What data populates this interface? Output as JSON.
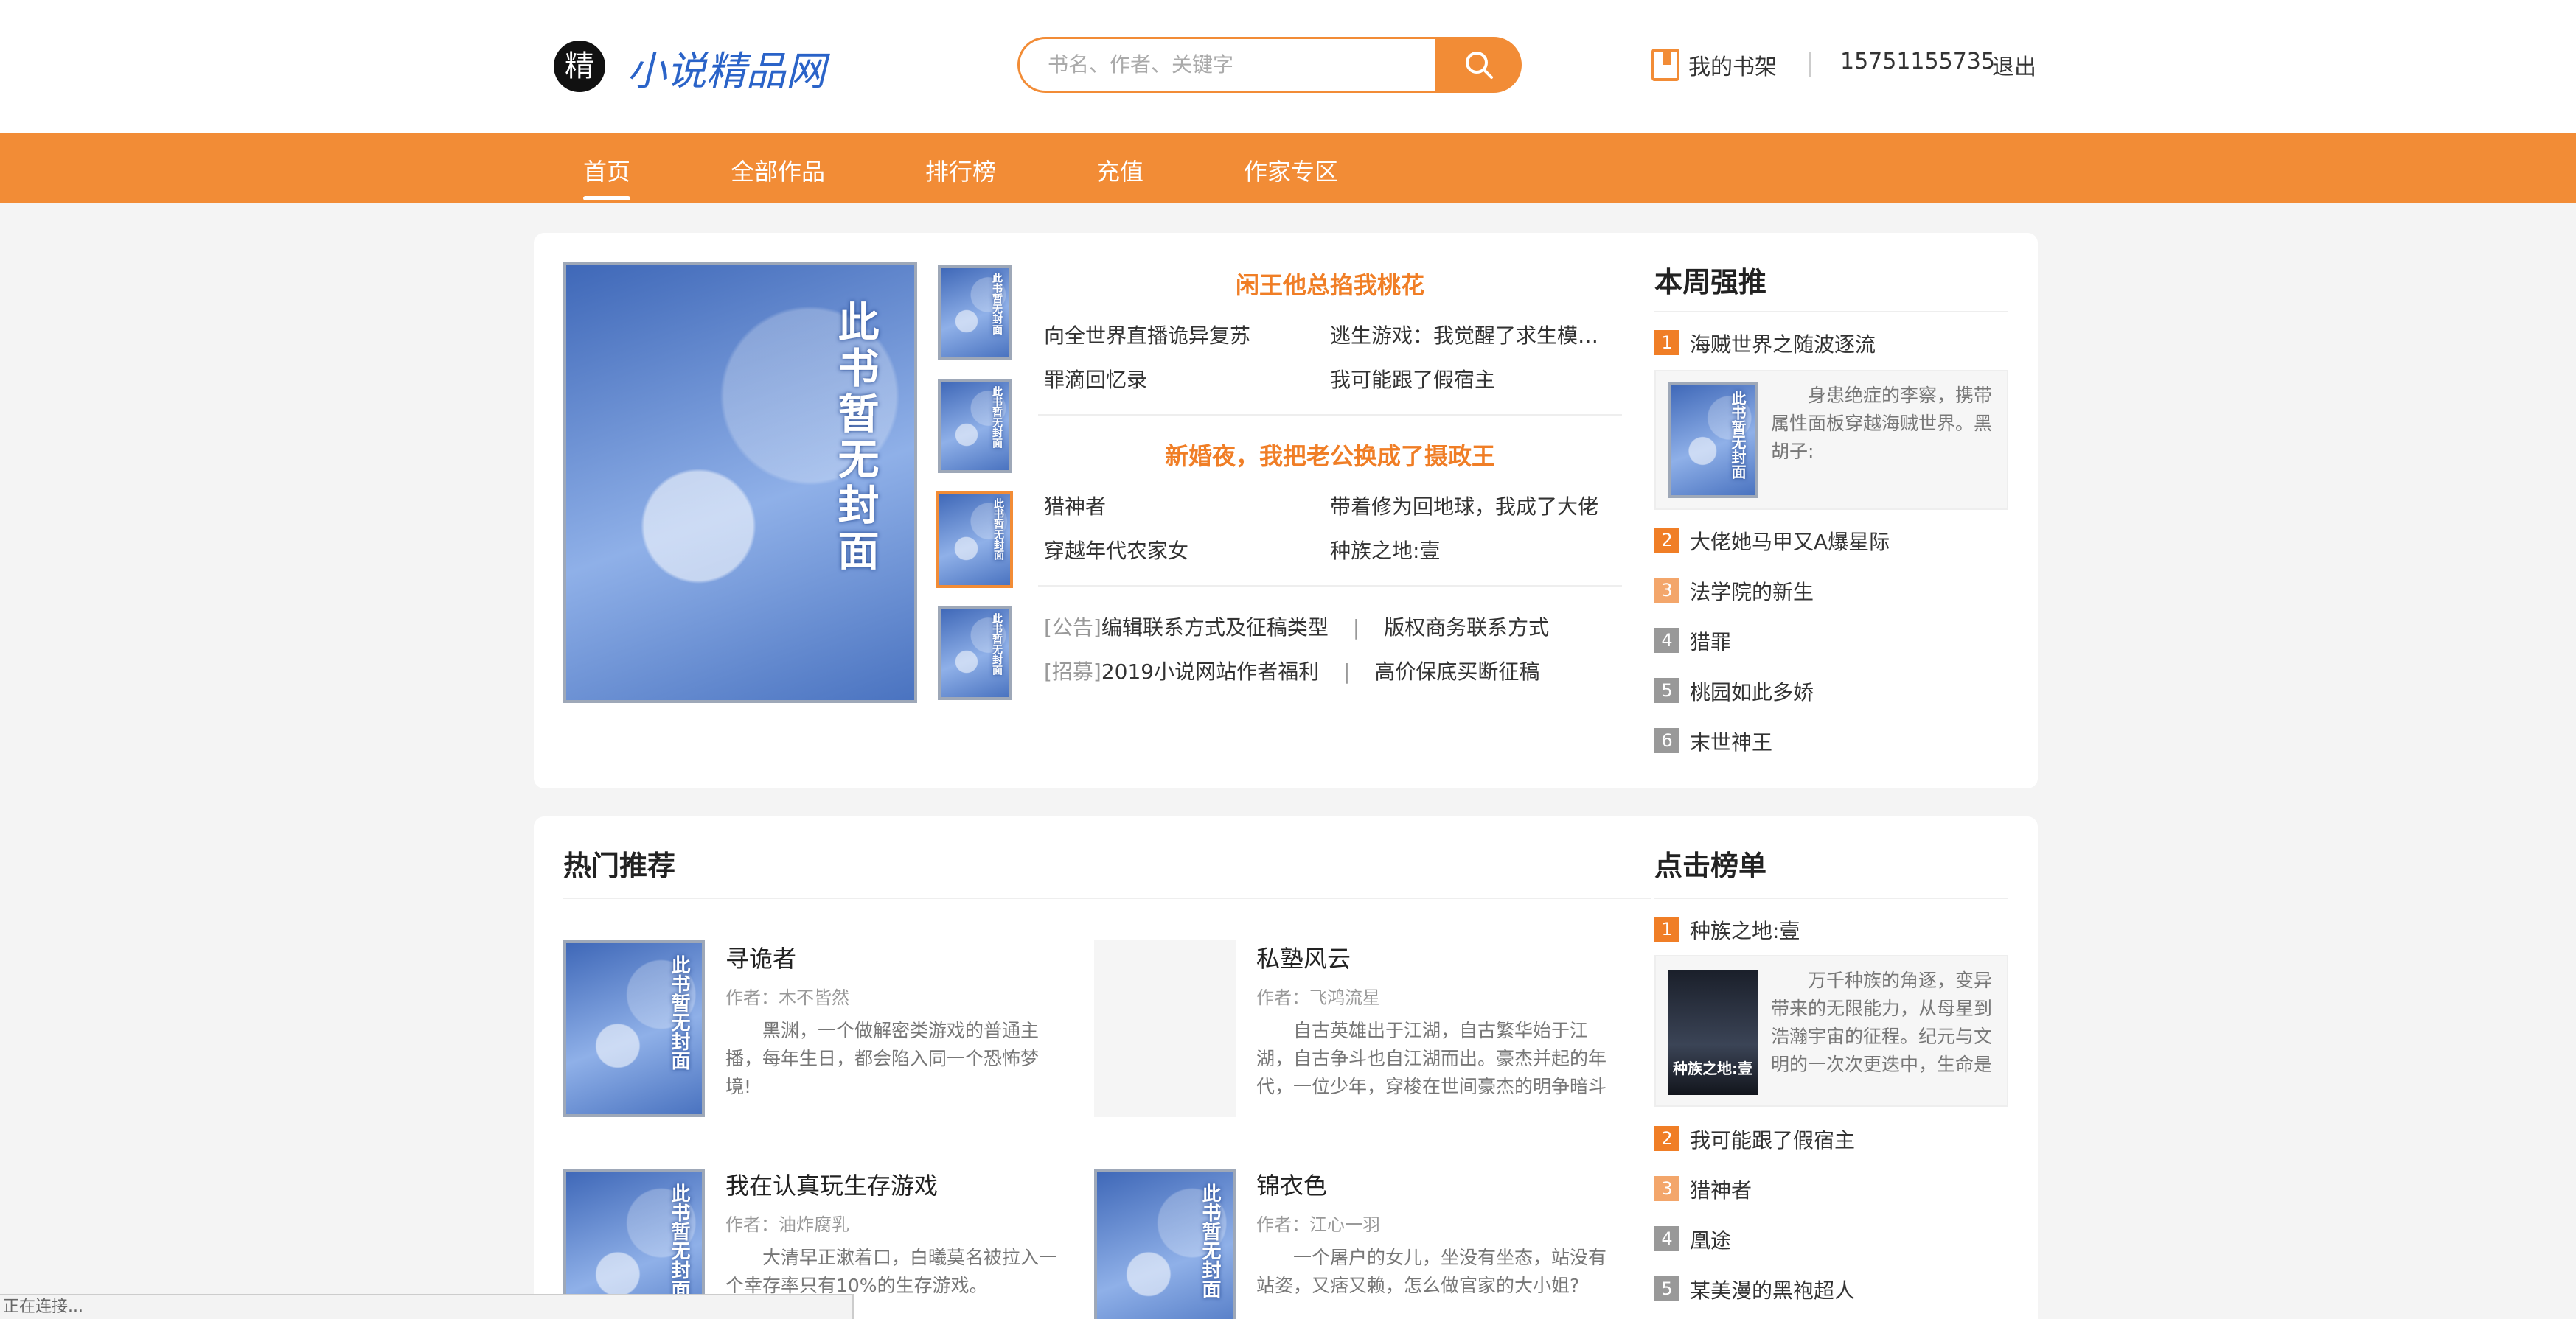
{
  "header": {
    "logo_badge": "精",
    "site_name": "小说精品网",
    "search_placeholder": "书名、作者、关键字",
    "bookshelf": "我的书架",
    "phone": "15751155735",
    "logout": "退出"
  },
  "nav": [
    "首页",
    "全部作品",
    "排行榜",
    "充值",
    "作家专区"
  ],
  "cover_text": "此书暂无封面",
  "featured": {
    "group1": {
      "title": "闲王他总掐我桃花",
      "links": [
        "向全世界直播诡异复苏",
        "逃生游戏：我觉醒了求生模…",
        "罪滴回忆录",
        "我可能跟了假宿主"
      ]
    },
    "group2": {
      "title": "新婚夜，我把老公换成了摄政王",
      "links": [
        "猎神者",
        "带着修为回地球，我成了大佬",
        "穿越年代农家女",
        "种族之地:壹"
      ]
    },
    "notices": [
      {
        "tag": "[公告]",
        "a": "编辑联系方式及征稿类型",
        "sep": "|",
        "b": "版权商务联系方式"
      },
      {
        "tag": "[招募]",
        "a": "2019小说网站作者福利",
        "sep": "|",
        "b": "高价保底买断征稿"
      }
    ]
  },
  "weekly": {
    "title": "本周强推",
    "items": [
      {
        "num": "1",
        "name": "海贼世界之随波逐流",
        "desc": "身患绝症的李察，携带属性面板穿越海贼世界。黑胡子:"
      },
      {
        "num": "2",
        "name": "大佬她马甲又A爆星际"
      },
      {
        "num": "3",
        "name": "法学院的新生"
      },
      {
        "num": "4",
        "name": "猎罪"
      },
      {
        "num": "5",
        "name": "桃园如此多娇"
      },
      {
        "num": "6",
        "name": "末世神王"
      }
    ]
  },
  "hot": {
    "title": "热门推荐",
    "books": [
      {
        "title": "寻诡者",
        "author": "作者：木不皆然",
        "desc": "黑渊，一个做解密类游戏的普通主播，每年生日，都会陷入同一个恐怖梦境!"
      },
      {
        "title": "私塾风云",
        "author": "作者：飞鸿流星",
        "desc": "自古英雄出于江湖，自古繁华始于江湖，自古争斗也自江湖而出。豪杰并起的年代，一位少年，穿梭在世间豪杰的明争暗斗"
      },
      {
        "title": "我在认真玩生存游戏",
        "author": "作者：油炸腐乳",
        "desc": "大清早正漱着口，白曦莫名被拉入一个幸存率只有10%的生存游戏。"
      },
      {
        "title": "锦衣色",
        "author": "作者：江心一羽",
        "desc": "一个屠户的女儿，坐没有坐态，站没有站姿，又痞又赖，怎么做官家的大小姐?"
      }
    ]
  },
  "clicks": {
    "title": "点击榜单",
    "items": [
      {
        "num": "1",
        "name": "种族之地:壹",
        "desc": "万千种族的角逐，变异带来的无限能力，从母星到浩瀚宇宙的征程。纪元与文明的一次次更迭中，生命是否"
      },
      {
        "num": "2",
        "name": "我可能跟了假宿主"
      },
      {
        "num": "3",
        "name": "猎神者"
      },
      {
        "num": "4",
        "name": "凰途"
      },
      {
        "num": "5",
        "name": "某美漫的黑袍超人"
      }
    ],
    "cover_title": "种族之地:壹"
  },
  "status": "正在连接...",
  "colors": {
    "accent": "#f28c36",
    "rank_top": "#f07e26",
    "rank_mid": "#f3a66b",
    "rank_low": "#999999",
    "logo_blue": "#2a63c8"
  }
}
